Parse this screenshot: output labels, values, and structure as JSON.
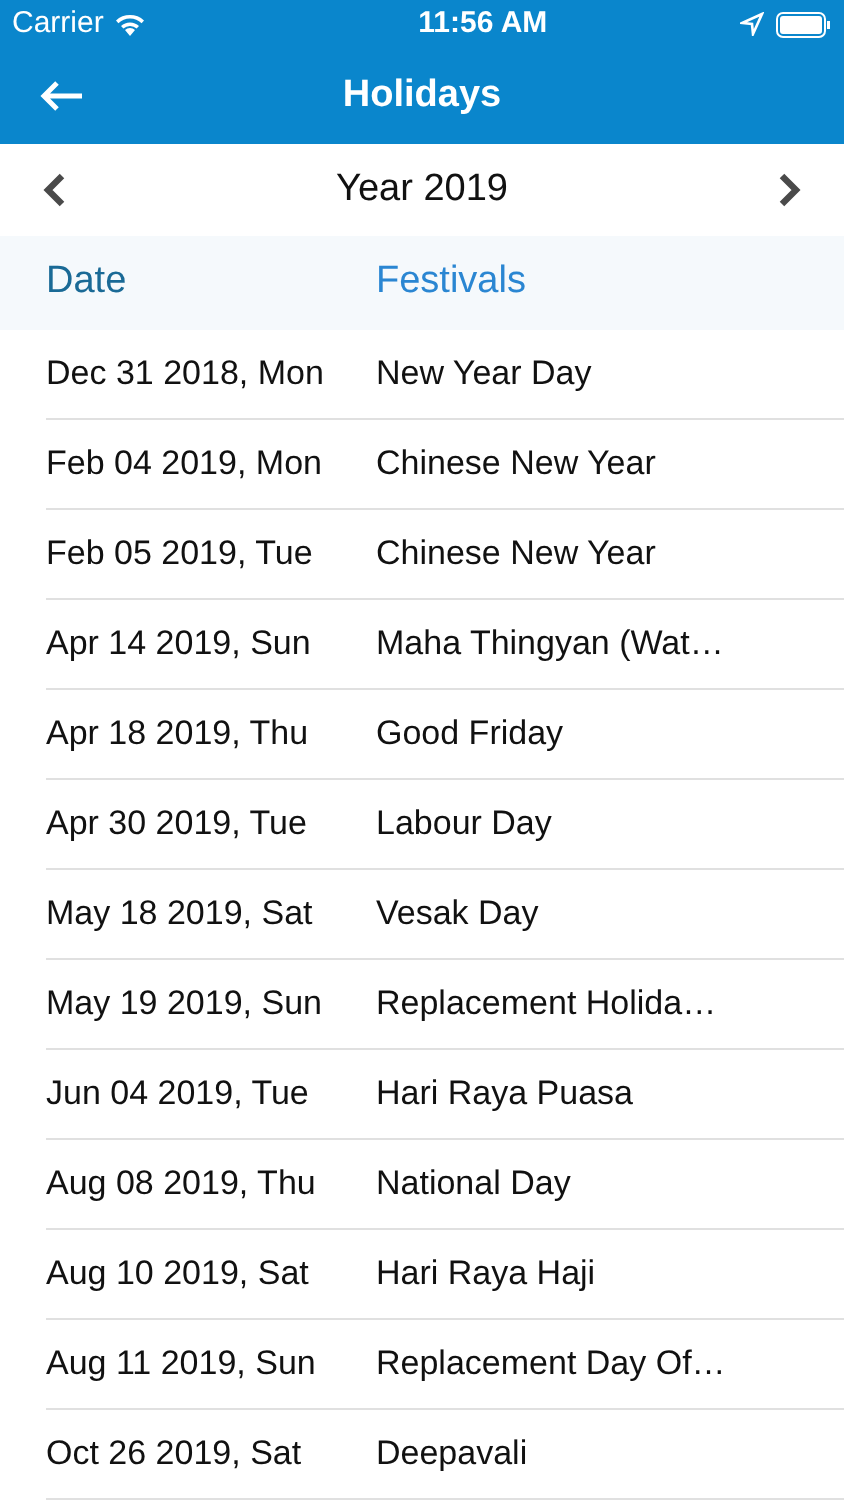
{
  "status_bar": {
    "carrier": "Carrier",
    "time": "11:56 AM"
  },
  "nav_bar": {
    "title": "Holidays"
  },
  "year_selector": {
    "label": "Year 2019"
  },
  "table": {
    "columns": [
      "Date",
      "Festivals"
    ],
    "rows": [
      {
        "date": "Dec 31 2018, Mon",
        "festival": "New Year Day"
      },
      {
        "date": "Feb 04 2019, Mon",
        "festival": "Chinese New Year"
      },
      {
        "date": "Feb 05 2019, Tue",
        "festival": "Chinese New Year"
      },
      {
        "date": "Apr 14 2019, Sun",
        "festival": "Maha Thingyan (Wat…"
      },
      {
        "date": "Apr 18 2019, Thu",
        "festival": "Good Friday"
      },
      {
        "date": "Apr 30 2019, Tue",
        "festival": "Labour Day"
      },
      {
        "date": "May 18 2019, Sat",
        "festival": "Vesak Day"
      },
      {
        "date": "May 19 2019, Sun",
        "festival": "Replacement Holida…"
      },
      {
        "date": "Jun 04 2019, Tue",
        "festival": "Hari Raya Puasa"
      },
      {
        "date": "Aug 08 2019, Thu",
        "festival": "National Day"
      },
      {
        "date": "Aug 10 2019, Sat",
        "festival": "Hari Raya Haji"
      },
      {
        "date": "Aug 11 2019, Sun",
        "festival": "Replacement Day Of…"
      },
      {
        "date": "Oct 26 2019, Sat",
        "festival": "Deepavali"
      }
    ]
  }
}
